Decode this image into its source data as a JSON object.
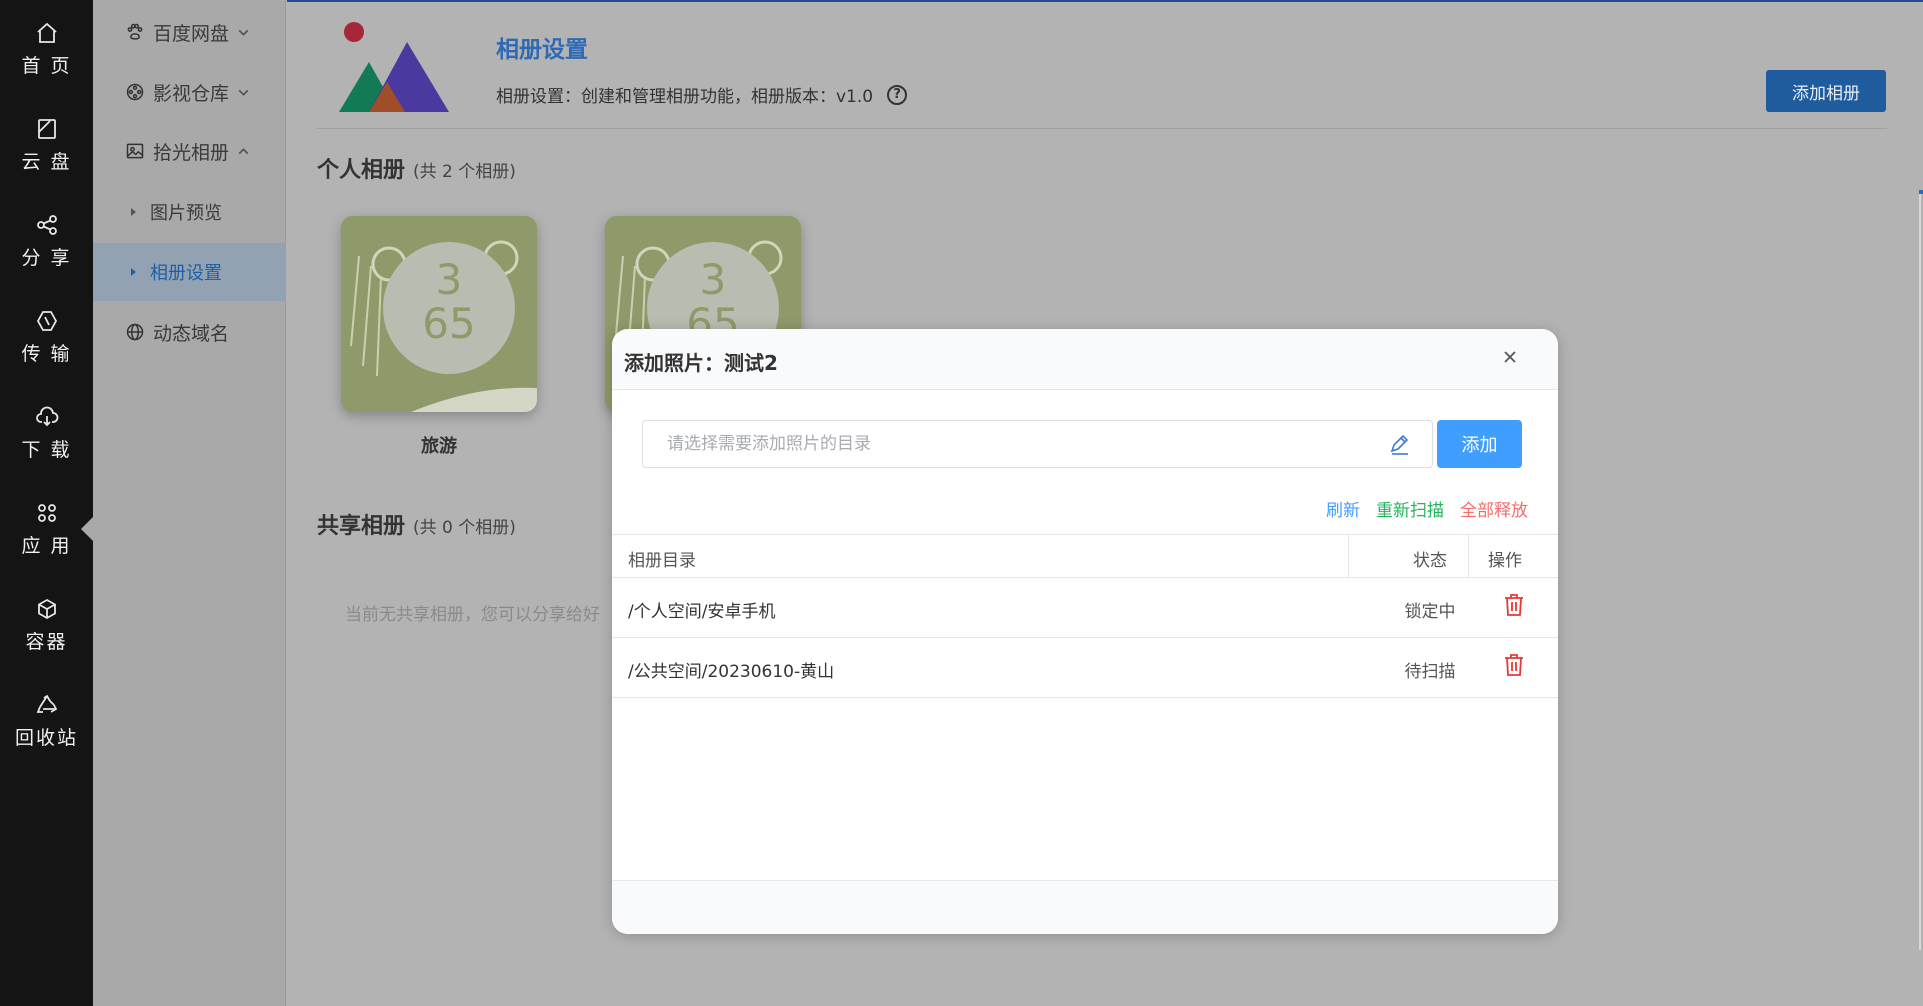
{
  "rail": {
    "items": [
      {
        "label": "首 页",
        "icon": "home-icon"
      },
      {
        "label": "云 盘",
        "icon": "cloud-disk-icon"
      },
      {
        "label": "分 享",
        "icon": "share-icon"
      },
      {
        "label": "传 输",
        "icon": "transfer-icon"
      },
      {
        "label": "下 载",
        "icon": "download-icon"
      },
      {
        "label": "应 用",
        "icon": "apps-icon"
      },
      {
        "label": "容器",
        "icon": "container-icon"
      },
      {
        "label": "回收站",
        "icon": "recycle-icon"
      }
    ]
  },
  "sidebar": {
    "items": [
      {
        "label": "百度网盘"
      },
      {
        "label": "影视仓库"
      },
      {
        "label": "拾光相册"
      },
      {
        "label": "图片预览"
      },
      {
        "label": "相册设置"
      },
      {
        "label": "动态域名"
      }
    ]
  },
  "header": {
    "title": "相册设置",
    "desc": "相册设置：创建和管理相册功能，相册版本：v1.0",
    "add_album": "添加相册"
  },
  "personal": {
    "title": "个人相册",
    "count": "(共 2 个相册)",
    "albums": [
      {
        "name": "旅游"
      },
      {
        "name": ""
      }
    ]
  },
  "shared": {
    "title": "共享相册",
    "count": "(共 0 个相册)",
    "empty": "当前无共享相册，您可以分享给好"
  },
  "modal": {
    "title": "添加照片：测试2",
    "placeholder": "请选择需要添加照片的目录",
    "add": "添加",
    "refresh": "刷新",
    "rescan": "重新扫描",
    "release_all": "全部释放",
    "columns": {
      "dir": "相册目录",
      "status": "状态",
      "op": "操作"
    },
    "rows": [
      {
        "dir": "/个人空间/安卓手机",
        "status": "锁定中"
      },
      {
        "dir": "/公共空间/20230610-黄山",
        "status": "待扫描"
      }
    ]
  },
  "colors": {
    "primary": "#409eff",
    "rescan": "#22b55a",
    "release": "#f56c6c",
    "delete": "#e53935"
  }
}
